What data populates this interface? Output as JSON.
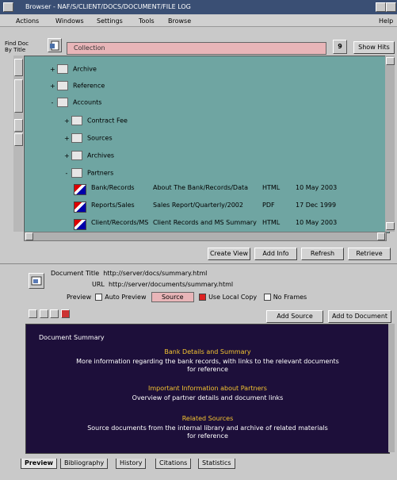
{
  "window": {
    "title": "Browser - NAF/S/CLIENT/DOCS/DOCUMENT/FILE LOG"
  },
  "menu": [
    "Actions",
    "Windows",
    "Settings",
    "Tools",
    "Browse"
  ],
  "menu_right": "Help",
  "toolbar": {
    "label_top": "Find Doc",
    "label_bottom": "By Title",
    "location_value": "Collection",
    "page_count": "9",
    "right_button": "Show Hits"
  },
  "tree": {
    "folders": [
      {
        "label": "Archive",
        "expander": "+"
      },
      {
        "label": "Reference",
        "expander": "+"
      },
      {
        "label": "Accounts",
        "expander": "-"
      },
      {
        "label": "Contract Fee",
        "expander": "+"
      },
      {
        "label": "Sources",
        "expander": "+"
      },
      {
        "label": "Archives",
        "expander": "+"
      },
      {
        "label": "Partners",
        "expander": "-"
      }
    ],
    "documents": [
      {
        "name": "Bank/Records",
        "title": "About The Bank/Records/Data",
        "type": "HTML",
        "date": "10 May 2003"
      },
      {
        "name": "Reports/Sales",
        "title": "Sales Report/Quarterly/2002",
        "type": "PDF",
        "date": "17 Dec 1999"
      },
      {
        "name": "Client/Records/MS",
        "title": "Client Records and MS Summary",
        "type": "HTML",
        "date": "10 May 2003"
      }
    ]
  },
  "tree_buttons": [
    "Create View",
    "Add Info",
    "Refresh",
    "Retrieve"
  ],
  "detail": {
    "doc_title_label": "Document Title",
    "doc_title_value": "http://server/docs/summary.html",
    "url_label": "URL",
    "url_value": "http://server/documents/summary.html",
    "preview_label": "Preview",
    "opt1": "Auto Preview",
    "opt2": "Source",
    "opt3": "Use Local Copy",
    "opt4": "No Frames",
    "nav_icons": [
      "back-icon",
      "forward-icon",
      "copy-icon",
      "stop-icon"
    ],
    "btn_right1": "Add Source",
    "btn_right2": "Add to Document"
  },
  "summary": {
    "heading": "Document Summary",
    "entries": [
      {
        "link": "Bank Details and Summary",
        "text1": "More information regarding the bank records, with links to the relevant documents",
        "text2": "for reference"
      },
      {
        "link": "Important Information about Partners",
        "text1": "Overview of partner details and document links"
      },
      {
        "link": "Related Sources",
        "text1": "Source documents from the internal library and archive of related materials",
        "text2": "for reference"
      }
    ]
  },
  "tabs": [
    "Preview",
    "Bibliography",
    "History",
    "Citations",
    "Statistics"
  ],
  "active_tab": 0,
  "colors": {
    "tree_bg": "#6fa5a2",
    "summary_bg": "#1d0f3a",
    "link": "#f4c430",
    "location_bg": "#e8b5b8"
  }
}
